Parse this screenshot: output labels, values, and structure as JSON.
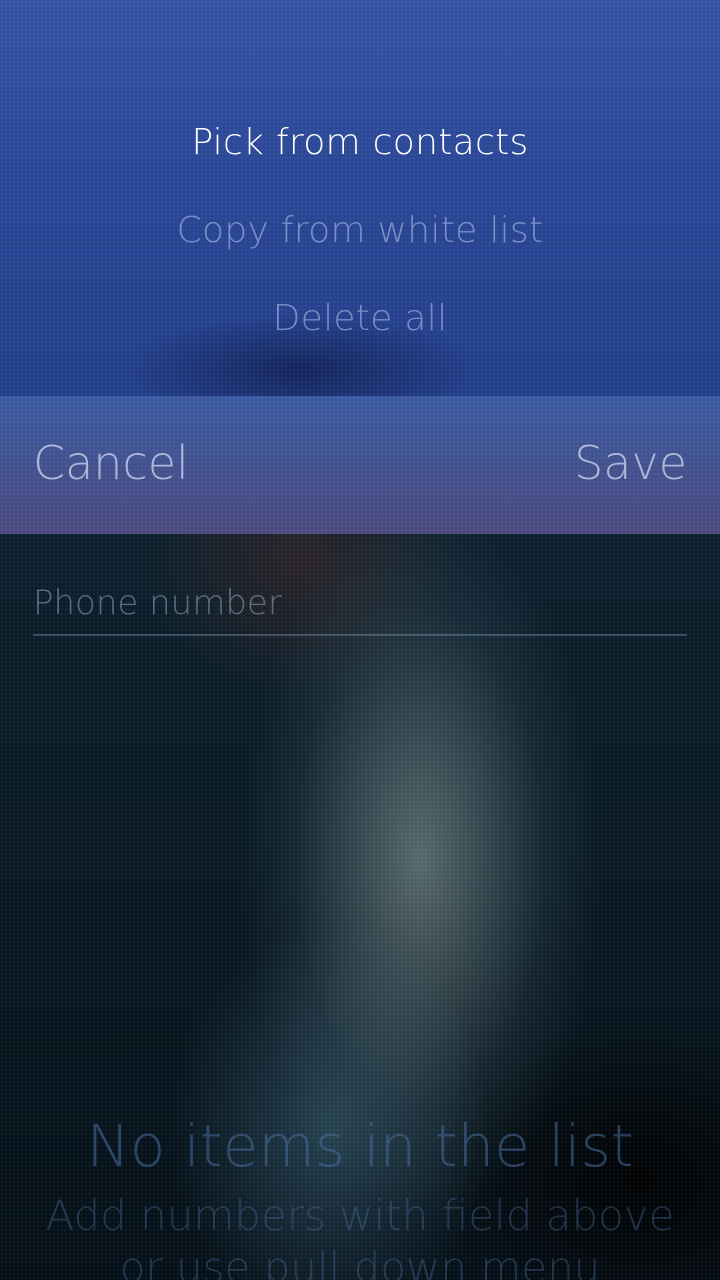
{
  "pulldown_menu": {
    "items": [
      {
        "label": "Pick from contacts",
        "active": true
      },
      {
        "label": "Copy from white list",
        "active": false
      },
      {
        "label": "Delete all",
        "active": false
      }
    ]
  },
  "dialog_header": {
    "cancel_label": "Cancel",
    "save_label": "Save"
  },
  "phone_input": {
    "placeholder": "Phone number",
    "value": ""
  },
  "empty_state": {
    "title": "No items in the list",
    "hint": "Add numbers with field above or use pull down menu"
  },
  "colors": {
    "menu_background": "#2a4796",
    "header_background": "#42528f",
    "page_background": "#0c2432"
  }
}
